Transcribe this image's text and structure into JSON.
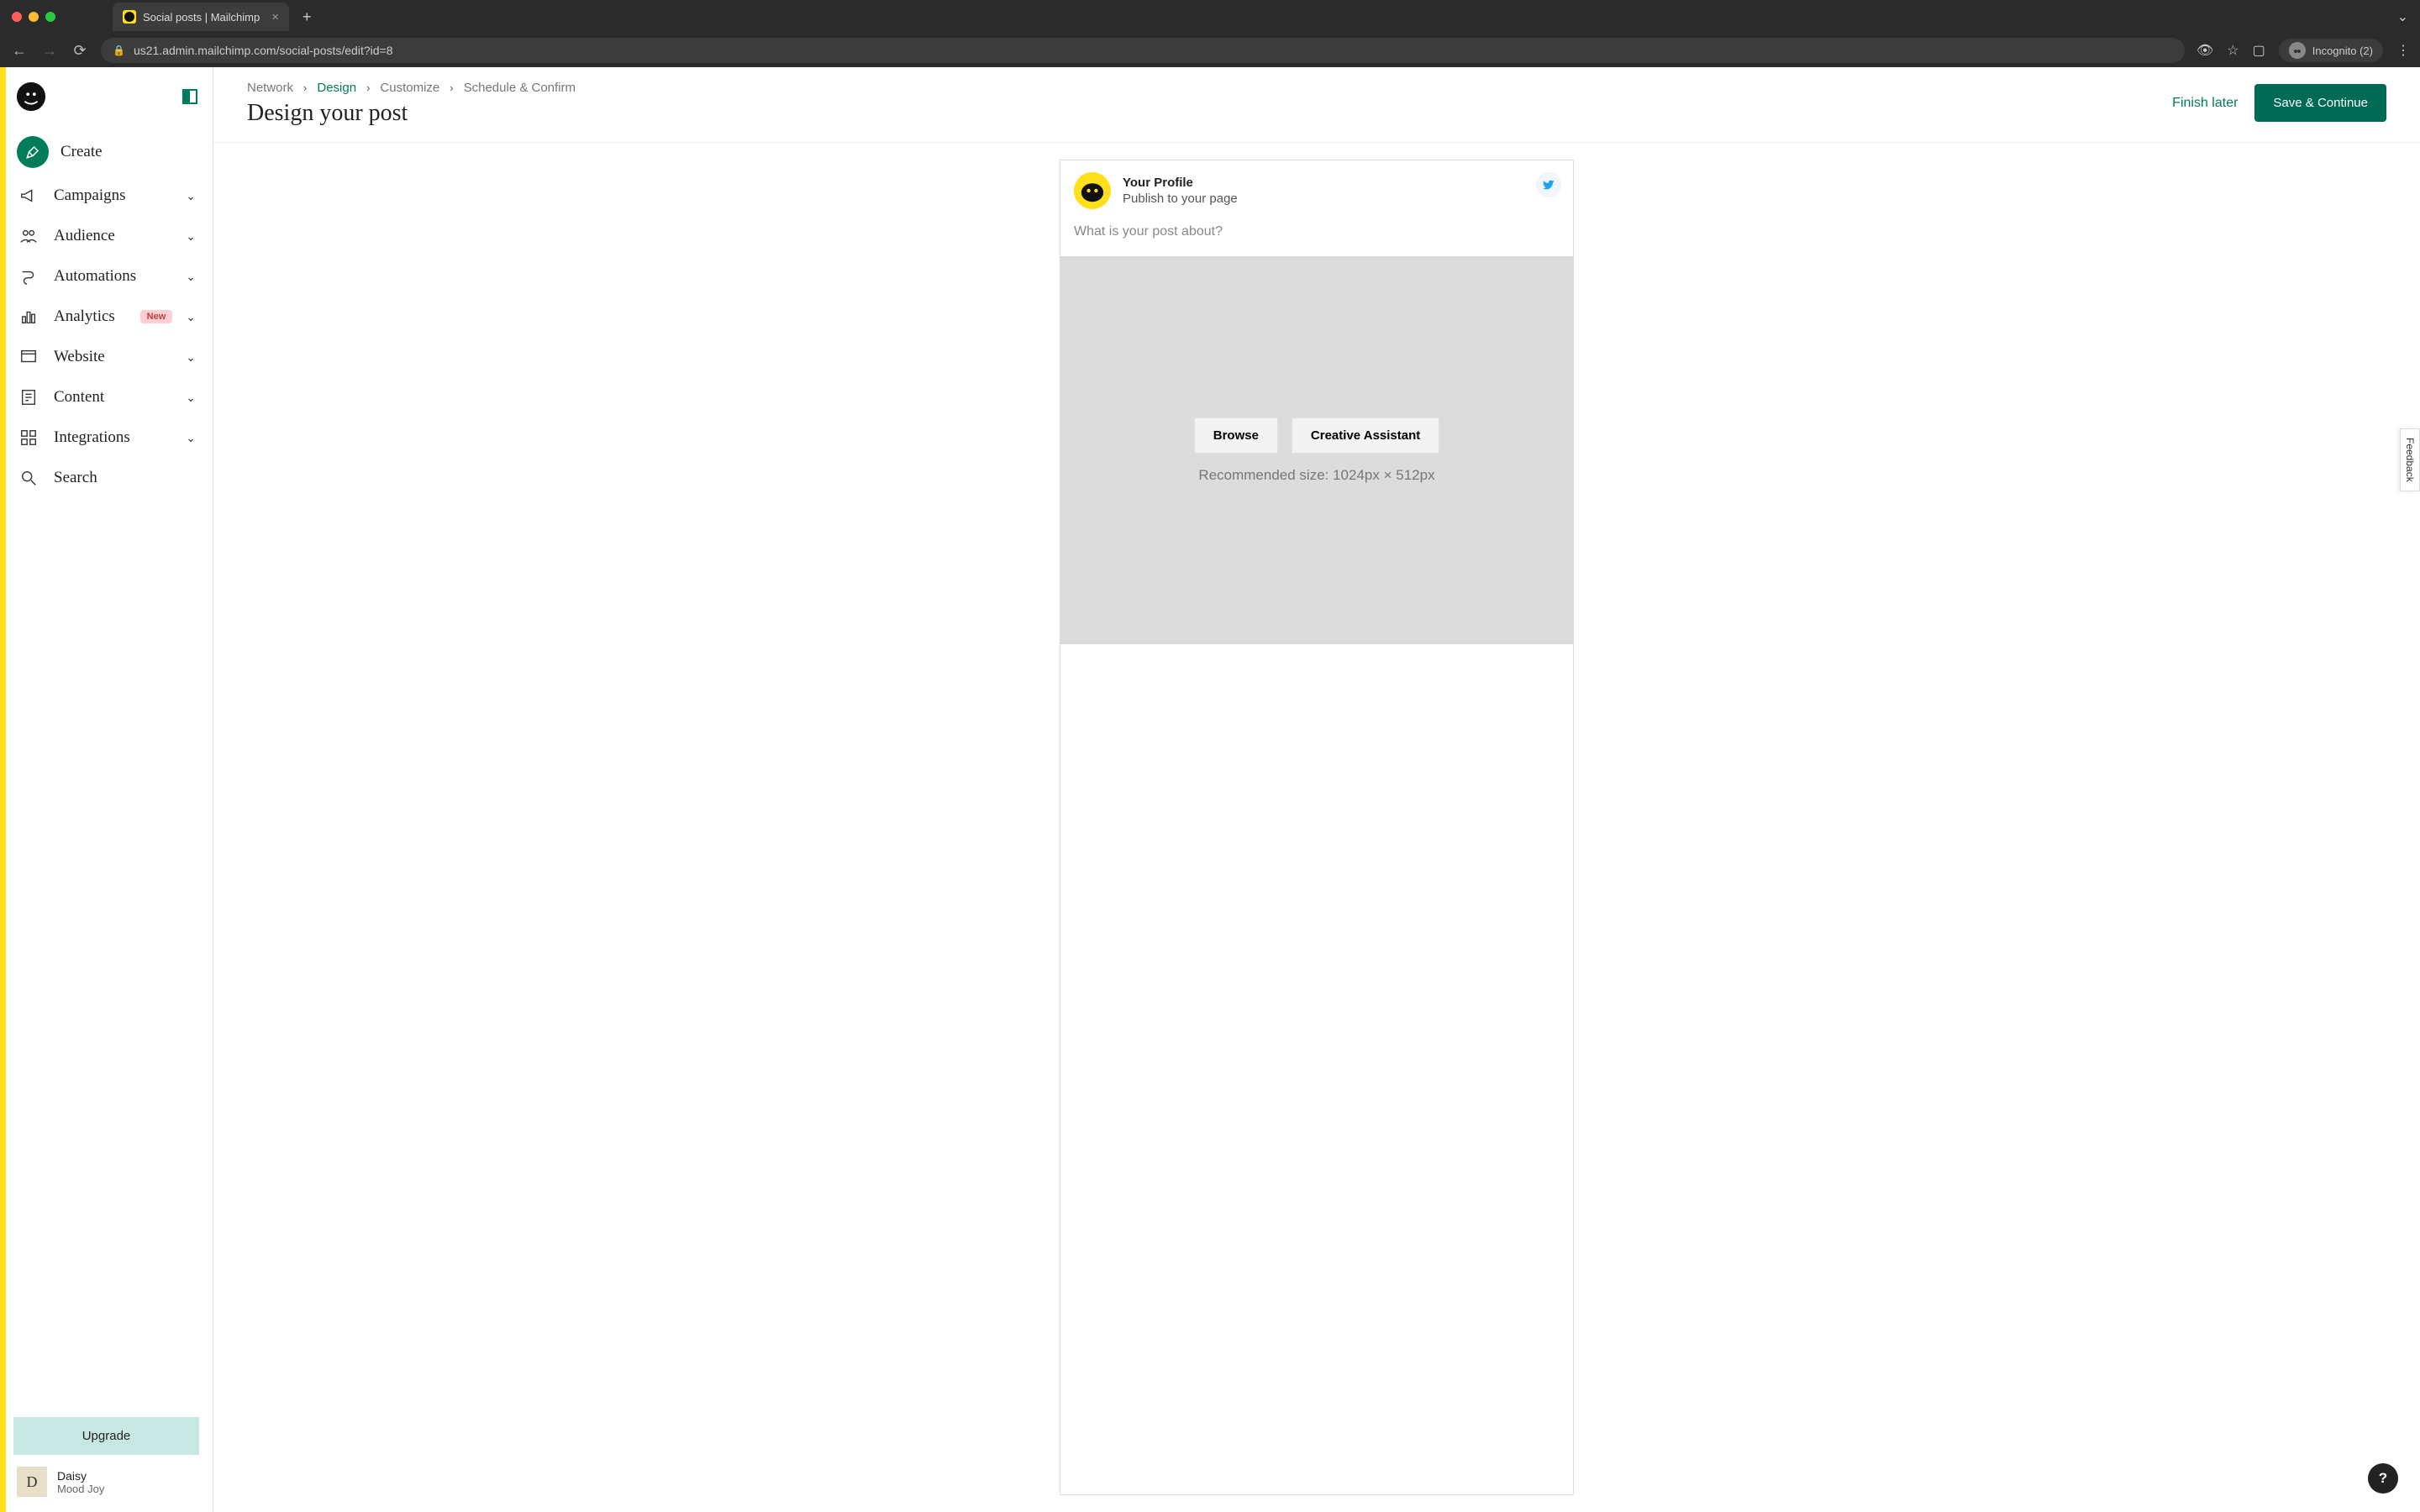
{
  "browser": {
    "tab_title": "Social posts | Mailchimp",
    "url": "us21.admin.mailchimp.com/social-posts/edit?id=8",
    "incognito_label": "Incognito (2)"
  },
  "sidebar": {
    "create_label": "Create",
    "items": [
      {
        "label": "Campaigns"
      },
      {
        "label": "Audience"
      },
      {
        "label": "Automations"
      },
      {
        "label": "Analytics",
        "badge": "New"
      },
      {
        "label": "Website"
      },
      {
        "label": "Content"
      },
      {
        "label": "Integrations"
      },
      {
        "label": "Search"
      }
    ],
    "upgrade_label": "Upgrade",
    "user": {
      "initial": "D",
      "name": "Daisy",
      "sub": "Mood Joy"
    }
  },
  "header": {
    "breadcrumb": [
      "Network",
      "Design",
      "Customize",
      "Schedule & Confirm"
    ],
    "active_index": 1,
    "title": "Design your post",
    "finish_label": "Finish later",
    "save_label": "Save & Continue"
  },
  "post": {
    "profile_name": "Your Profile",
    "profile_sub": "Publish to your page",
    "placeholder": "What is your post about?",
    "browse_label": "Browse",
    "creative_label": "Creative Assistant",
    "size_hint": "Recommended size: 1024px × 512px"
  },
  "misc": {
    "feedback_label": "Feedback",
    "help_label": "?"
  }
}
